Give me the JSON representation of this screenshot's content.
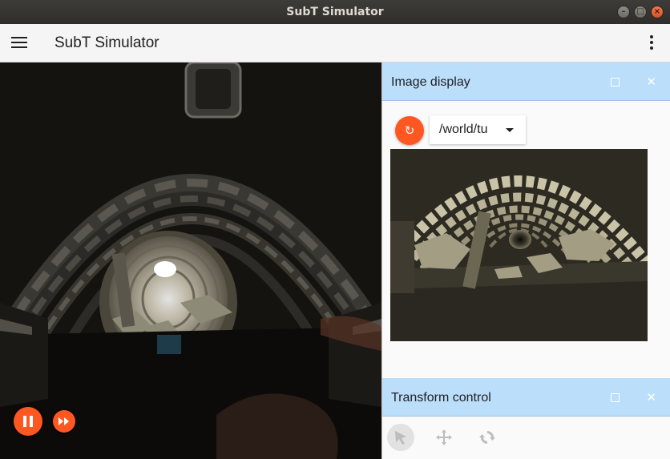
{
  "window": {
    "title": "SubT Simulator",
    "controls": [
      "minimize",
      "maximize",
      "close"
    ]
  },
  "appbar": {
    "title": "SubT Simulator",
    "menu_icon": "hamburger-menu-icon",
    "overflow_icon": "more-vert-icon"
  },
  "scene": {
    "controls": {
      "pause_icon": "pause-icon",
      "step_icon": "fast-forward-icon"
    }
  },
  "image_display": {
    "title": "Image display",
    "topic": "/world/tu",
    "refresh_icon": "↻"
  },
  "transform_control": {
    "title": "Transform control",
    "tools": [
      "select-arrow-icon",
      "translate-icon",
      "rotate-icon"
    ]
  },
  "colors": {
    "accent": "#ff5722",
    "plugin_header": "#bbdefb",
    "titlebar": "#33322f"
  }
}
